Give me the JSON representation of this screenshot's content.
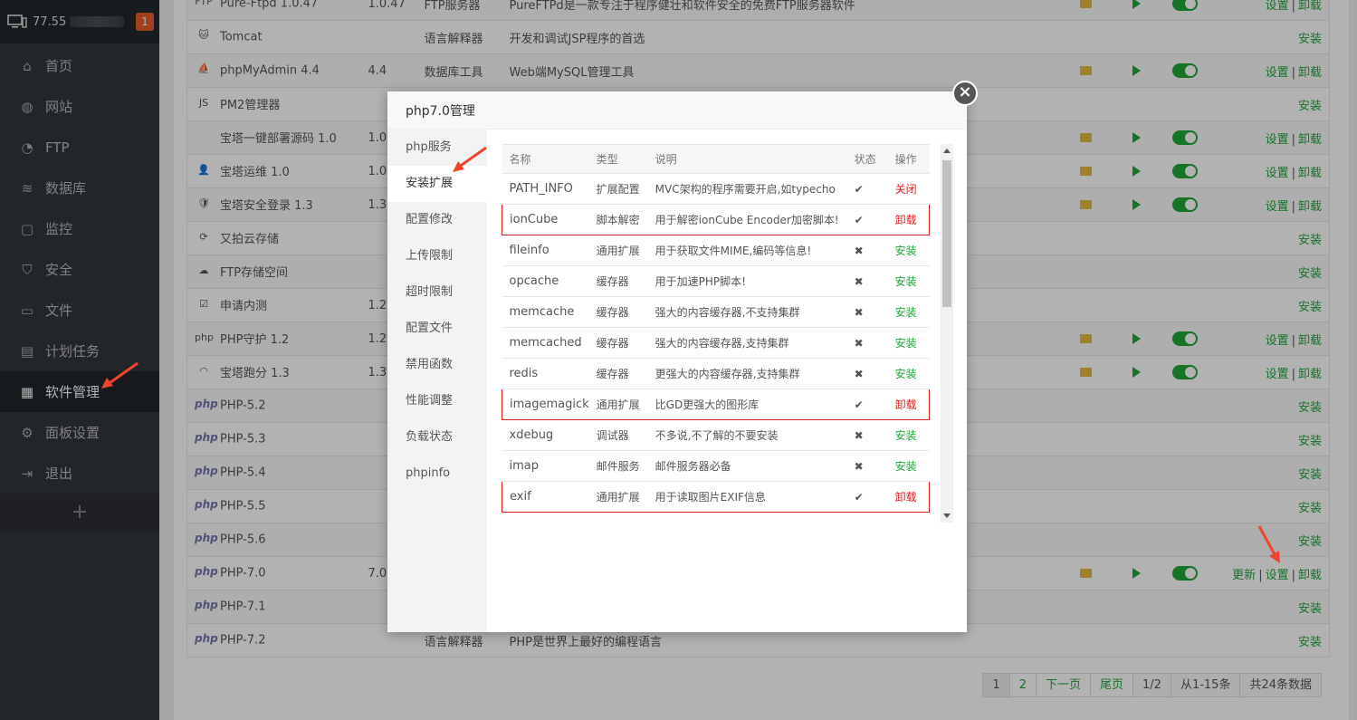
{
  "sidebar": {
    "ip": "77.55",
    "badge": "1",
    "items": [
      {
        "label": "首页",
        "icon": "home-icon"
      },
      {
        "label": "网站",
        "icon": "globe-icon"
      },
      {
        "label": "FTP",
        "icon": "ftp-icon"
      },
      {
        "label": "数据库",
        "icon": "database-icon"
      },
      {
        "label": "监控",
        "icon": "monitor-icon"
      },
      {
        "label": "安全",
        "icon": "shield-icon"
      },
      {
        "label": "文件",
        "icon": "folder-icon"
      },
      {
        "label": "计划任务",
        "icon": "calendar-icon"
      },
      {
        "label": "软件管理",
        "icon": "grid-icon"
      },
      {
        "label": "面板设置",
        "icon": "gear-icon"
      },
      {
        "label": "退出",
        "icon": "logout-icon"
      }
    ],
    "plus": "+"
  },
  "software": [
    {
      "name": "Pure-Ftpd 1.0.47",
      "ver": "1.0.47",
      "type": "FTP服务器",
      "desc": "PureFTPd是一款专注于程序健壮和软件安全的免费FTP服务器软件",
      "installed": true,
      "action": "设置",
      "action2": "卸载"
    },
    {
      "name": "Tomcat",
      "ver": "",
      "type": "语言解释器",
      "desc": "开发和调试JSP程序的首选",
      "installed": false,
      "action": "安装"
    },
    {
      "name": "phpMyAdmin 4.4",
      "ver": "4.4",
      "type": "数据库工具",
      "desc": "Web端MySQL管理工具",
      "installed": true,
      "action": "设置",
      "action2": "卸载"
    },
    {
      "name": "PM2管理器",
      "ver": "",
      "type": "",
      "desc": "",
      "installed": false,
      "action": "安装"
    },
    {
      "name": "宝塔一键部署源码 1.0",
      "ver": "1.0",
      "type": "",
      "desc": "",
      "installed": true,
      "action": "设置",
      "action2": "卸载"
    },
    {
      "name": "宝塔运维 1.0",
      "ver": "1.0",
      "type": "",
      "desc": "",
      "installed": true,
      "action": "设置",
      "action2": "卸载"
    },
    {
      "name": "宝塔安全登录 1.3",
      "ver": "1.3",
      "type": "",
      "desc": "",
      "installed": true,
      "action": "设置",
      "action2": "卸载"
    },
    {
      "name": "又拍云存储",
      "ver": "",
      "type": "",
      "desc": "",
      "installed": false,
      "action": "安装"
    },
    {
      "name": "FTP存储空间",
      "ver": "",
      "type": "",
      "desc": "",
      "installed": false,
      "action": "安装"
    },
    {
      "name": "申请内测",
      "ver": "1.2",
      "type": "",
      "desc": "",
      "installed": false,
      "action": "安装"
    },
    {
      "name": "PHP守护 1.2",
      "ver": "1.2",
      "type": "",
      "desc": "",
      "installed": true,
      "action": "设置",
      "action2": "卸载"
    },
    {
      "name": "宝塔跑分 1.3",
      "ver": "1.3",
      "type": "",
      "desc": "",
      "installed": true,
      "action": "设置",
      "action2": "卸载"
    },
    {
      "name": "PHP-5.2",
      "ver": "",
      "type": "",
      "desc": "",
      "installed": false,
      "action": "安装"
    },
    {
      "name": "PHP-5.3",
      "ver": "",
      "type": "",
      "desc": "",
      "installed": false,
      "action": "安装"
    },
    {
      "name": "PHP-5.4",
      "ver": "",
      "type": "",
      "desc": "",
      "installed": false,
      "action": "安装"
    },
    {
      "name": "PHP-5.5",
      "ver": "",
      "type": "",
      "desc": "",
      "installed": false,
      "action": "安装"
    },
    {
      "name": "PHP-5.6",
      "ver": "",
      "type": "",
      "desc": "",
      "installed": false,
      "action": "安装"
    },
    {
      "name": "PHP-7.0",
      "ver": "7.0",
      "type": "",
      "desc": "",
      "installed": true,
      "action0": "更新",
      "action": "设置",
      "action2": "卸载"
    },
    {
      "name": "PHP-7.1",
      "ver": "",
      "type": "",
      "desc": "",
      "installed": false,
      "action": "安装"
    },
    {
      "name": "PHP-7.2",
      "ver": "",
      "type": "语言解释器",
      "desc": "PHP是世界上最好的编程语言",
      "installed": false,
      "action": "安装"
    }
  ],
  "pager": {
    "p1": "1",
    "p2": "2",
    "next": "下一页",
    "last": "尾页",
    "frac": "1/2",
    "range": "从1-15条",
    "total": "共24条数据"
  },
  "modal": {
    "title": "php7.0管理",
    "close": "×",
    "menu": [
      "php服务",
      "安装扩展",
      "配置修改",
      "上传限制",
      "超时限制",
      "配置文件",
      "禁用函数",
      "性能调整",
      "负载状态",
      "phpinfo"
    ],
    "headers": {
      "name": "名称",
      "type": "类型",
      "desc": "说明",
      "status": "状态",
      "op": "操作"
    },
    "extensions": [
      {
        "name": "PATH_INFO",
        "type": "扩展配置",
        "desc": "MVC架构的程序需要开启,如typecho",
        "status": "✔",
        "op": "关闭"
      },
      {
        "name": "ionCube",
        "type": "脚本解密",
        "desc": "用于解密ionCube Encoder加密脚本!",
        "status": "✔",
        "op": "卸载"
      },
      {
        "name": "fileinfo",
        "type": "通用扩展",
        "desc": "用于获取文件MIME,编码等信息!",
        "status": "✖",
        "op": "安装"
      },
      {
        "name": "opcache",
        "type": "缓存器",
        "desc": "用于加速PHP脚本!",
        "status": "✖",
        "op": "安装"
      },
      {
        "name": "memcache",
        "type": "缓存器",
        "desc": "强大的内容缓存器,不支持集群",
        "status": "✖",
        "op": "安装"
      },
      {
        "name": "memcached",
        "type": "缓存器",
        "desc": "强大的内容缓存器,支持集群",
        "status": "✖",
        "op": "安装"
      },
      {
        "name": "redis",
        "type": "缓存器",
        "desc": "更强大的内容缓存器,支持集群",
        "status": "✖",
        "op": "安装"
      },
      {
        "name": "imagemagick",
        "type": "通用扩展",
        "desc": "比GD更强大的图形库",
        "status": "✔",
        "op": "卸载"
      },
      {
        "name": "xdebug",
        "type": "调试器",
        "desc": "不多说,不了解的不要安装",
        "status": "✖",
        "op": "安装"
      },
      {
        "name": "imap",
        "type": "邮件服务",
        "desc": "邮件服务器必备",
        "status": "✖",
        "op": "安装"
      },
      {
        "name": "exif",
        "type": "通用扩展",
        "desc": "用于读取图片EXIF信息",
        "status": "✔",
        "op": "卸载"
      }
    ]
  },
  "colors": {
    "accent": "#20a53a",
    "danger": "#e02020",
    "sidebar": "#32363b",
    "arrow": "#f0442c"
  }
}
